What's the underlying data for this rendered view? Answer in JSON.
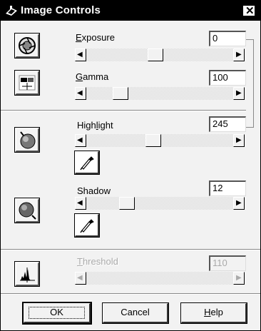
{
  "window": {
    "title": "Image Controls",
    "close_glyph": "✕"
  },
  "exposure": {
    "label_ul": "E",
    "label_rest": "xposure",
    "value": "0",
    "level": 0.47
  },
  "gamma": {
    "label_ul": "G",
    "label_rest": "amma",
    "value": "100",
    "level": 0.2
  },
  "highlight": {
    "label_pre": "High",
    "label_ul": "l",
    "label_rest": "ight",
    "value": "245",
    "level": 0.45
  },
  "shadow": {
    "label": "Shadow",
    "value": "12",
    "level": 0.25
  },
  "threshold": {
    "label_ul": "T",
    "label_rest": "hreshold",
    "value": "110",
    "enabled": false
  },
  "buttons": {
    "ok": "OK",
    "cancel": "Cancel",
    "help_ul": "H",
    "help_rest": "elp"
  },
  "icons": {
    "exposure": "aperture-icon",
    "gamma": "gamma-curve-icon",
    "highlight": "highlight-sphere-icon",
    "shadow": "shadow-sphere-icon",
    "threshold": "histogram-icon",
    "dropper": "eyedropper-icon",
    "title": "scanner-icon"
  }
}
